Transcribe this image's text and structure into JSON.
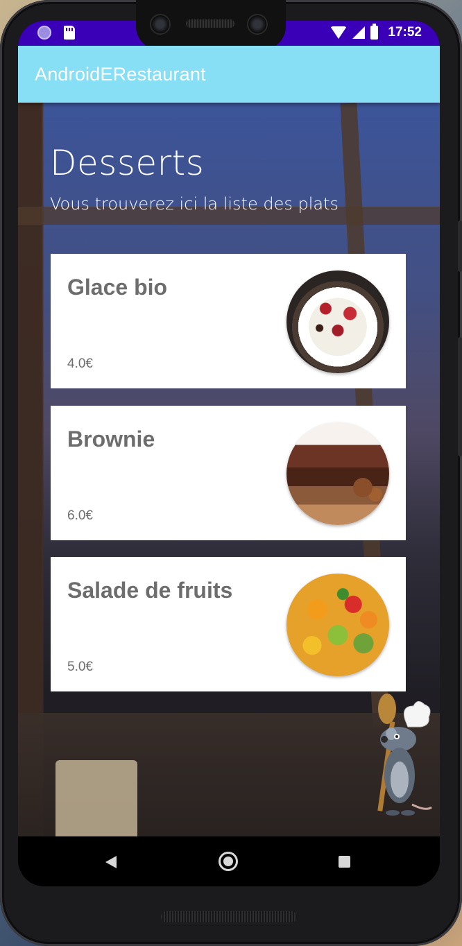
{
  "status_bar": {
    "time": "17:52",
    "icons": [
      "notification-dot-icon",
      "sd-card-icon",
      "wifi-icon",
      "signal-icon",
      "battery-icon"
    ]
  },
  "app_bar": {
    "title": "AndroidERestaurant",
    "color": "#87dff5"
  },
  "page": {
    "title": "Desserts",
    "subtitle": "Vous trouverez ici la liste des plats"
  },
  "dishes": [
    {
      "name": "Glace bio",
      "price": "4.0€",
      "image": "ice-cream-image"
    },
    {
      "name": "Brownie",
      "price": "6.0€",
      "image": "brownie-image"
    },
    {
      "name": "Salade de fruits",
      "price": "5.0€",
      "image": "fruit-salad-image"
    }
  ],
  "nav_bar": {
    "buttons": [
      "back-icon",
      "home-icon",
      "recent-apps-icon"
    ]
  },
  "colors": {
    "status_bar": "#3a00b8",
    "card_text": "#6d6d6d"
  }
}
